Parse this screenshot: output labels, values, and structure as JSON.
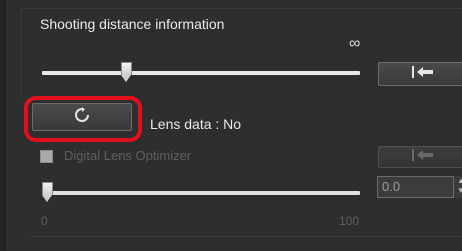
{
  "shooting_distance": {
    "title": "Shooting distance information",
    "infinity_symbol": "∞",
    "slider_value_fraction": 0.28,
    "apply_icon": "arrow-back-to-start-icon"
  },
  "lens": {
    "reset_icon": "rotate-refresh-icon",
    "status_text": "Lens data : No"
  },
  "dlo": {
    "checkbox_label": "Digital Lens Optimizer",
    "checked": false,
    "apply_icon": "arrow-back-to-start-icon",
    "slider_value_fraction": 0.0,
    "value": "0.0",
    "min_label": "0",
    "max_label": "100"
  },
  "colors": {
    "highlight": "#e3101c",
    "panel_bg": "#2e2e2e",
    "text": "#eaeaea",
    "disabled_text": "#5e5e5e"
  }
}
